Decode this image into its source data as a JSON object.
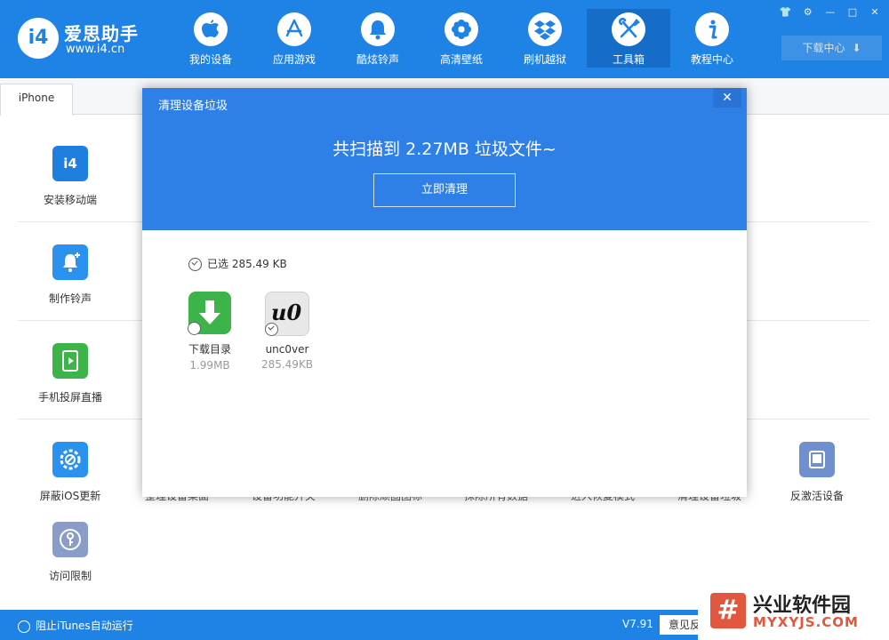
{
  "header": {
    "logo_mark": "i4",
    "logo_name": "爱思助手",
    "logo_url": "www.i4.cn",
    "nav": [
      {
        "label": "我的设备",
        "icon": "apple-icon"
      },
      {
        "label": "应用游戏",
        "icon": "app-store-icon"
      },
      {
        "label": "酷炫铃声",
        "icon": "bell-icon"
      },
      {
        "label": "高清壁纸",
        "icon": "flower-icon"
      },
      {
        "label": "刷机越狱",
        "icon": "dropbox-icon"
      },
      {
        "label": "工具箱",
        "icon": "tools-icon"
      },
      {
        "label": "教程中心",
        "icon": "info-icon"
      }
    ],
    "active_nav": "工具箱",
    "window_controls": [
      "👕",
      "⚙",
      "—",
      "□",
      "✕"
    ],
    "download_center": "下载中心",
    "download_arrow": "⬇"
  },
  "tabs": {
    "device": "iPhone"
  },
  "tools": {
    "col1": [
      "安装移动端",
      "制作铃声",
      "手机投屏直播",
      "屏蔽iOS更新",
      "访问限制"
    ],
    "right": "反激活设备",
    "partially_hidden": [
      "整理设备桌面",
      "设备功能开关",
      "删除顽固图标",
      "抹除所有数据",
      "进入恢复模式",
      "清理设备垃圾"
    ]
  },
  "modal": {
    "title": "清理设备垃圾",
    "close": "✕",
    "scan_result": "共扫描到 2.27MB 垃圾文件~",
    "clean_button": "立即清理",
    "selected": "已选 285.49 KB",
    "items": [
      {
        "name": "下载目录",
        "size": "1.99MB",
        "checked": false,
        "icon": "download-folder-icon"
      },
      {
        "name": "unc0ver",
        "size": "285.49KB",
        "checked": true,
        "icon": "unc0ver-app-icon",
        "icon_text": "u0"
      }
    ]
  },
  "status": {
    "itunes_toggle": "阻止iTunes自动运行",
    "version": "V7.91",
    "feedback": "意见反"
  },
  "watermark": {
    "mark": "#",
    "cn": "兴业软件园",
    "en": "MYXYJS.COM"
  },
  "colors": {
    "brand_blue": "#1f82e5",
    "modal_blue": "#2e7fe6",
    "green_tool": "#3cb44a",
    "watermark_red": "#e2583e"
  }
}
